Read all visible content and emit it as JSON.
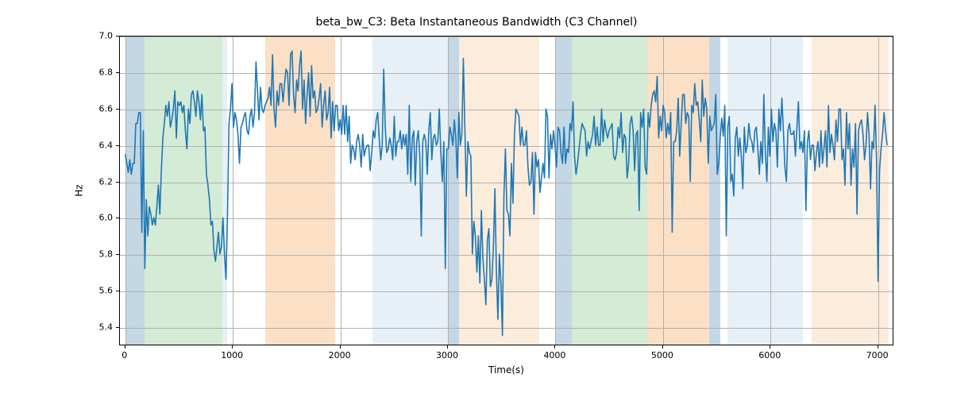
{
  "chart_data": {
    "type": "line",
    "title": "beta_bw_C3: Beta Instantaneous Bandwidth (C3 Channel)",
    "xlabel": "Time(s)",
    "ylabel": "Hz",
    "xlim": [
      -50,
      7150
    ],
    "ylim": [
      5.3,
      7.0
    ],
    "xticks": [
      0,
      1000,
      2000,
      3000,
      4000,
      5000,
      6000,
      7000
    ],
    "yticks": [
      5.4,
      5.6,
      5.8,
      6.0,
      6.2,
      6.4,
      6.6,
      6.8,
      7.0
    ],
    "bands": [
      {
        "start": 0,
        "end": 180,
        "color": "#b9d0df"
      },
      {
        "start": 180,
        "end": 900,
        "color": "#cde7ce"
      },
      {
        "start": 900,
        "end": 950,
        "color": "#e3edf4"
      },
      {
        "start": 1300,
        "end": 1950,
        "color": "#fbdabb"
      },
      {
        "start": 2300,
        "end": 3000,
        "color": "#e3edf4"
      },
      {
        "start": 3000,
        "end": 3100,
        "color": "#b9d0df"
      },
      {
        "start": 3100,
        "end": 3850,
        "color": "#fbe9d6"
      },
      {
        "start": 4000,
        "end": 4150,
        "color": "#b9d0df"
      },
      {
        "start": 4150,
        "end": 4850,
        "color": "#cde7ce"
      },
      {
        "start": 4850,
        "end": 5430,
        "color": "#fbdabb"
      },
      {
        "start": 5430,
        "end": 5530,
        "color": "#b9d0df"
      },
      {
        "start": 5600,
        "end": 6300,
        "color": "#e3edf4"
      },
      {
        "start": 6380,
        "end": 7100,
        "color": "#fbe9d6"
      }
    ],
    "x": [
      0,
      14,
      28,
      42,
      56,
      70,
      84,
      98,
      112,
      126,
      140,
      154,
      168,
      182,
      196,
      210,
      224,
      238,
      252,
      266,
      280,
      294,
      308,
      322,
      336,
      350,
      364,
      378,
      392,
      406,
      420,
      434,
      448,
      462,
      476,
      490,
      504,
      518,
      532,
      546,
      560,
      574,
      588,
      602,
      616,
      630,
      644,
      658,
      672,
      686,
      700,
      714,
      728,
      742,
      756,
      770,
      784,
      798,
      812,
      826,
      840,
      854,
      868,
      882,
      896,
      910,
      924,
      938,
      952,
      966,
      980,
      994,
      1008,
      1022,
      1036,
      1050,
      1064,
      1078,
      1092,
      1106,
      1120,
      1134,
      1148,
      1162,
      1176,
      1190,
      1204,
      1218,
      1232,
      1246,
      1260,
      1274,
      1288,
      1302,
      1316,
      1330,
      1344,
      1358,
      1372,
      1386,
      1400,
      1414,
      1428,
      1442,
      1456,
      1470,
      1484,
      1498,
      1512,
      1526,
      1540,
      1554,
      1568,
      1582,
      1596,
      1610,
      1624,
      1638,
      1652,
      1666,
      1680,
      1694,
      1708,
      1722,
      1736,
      1750,
      1764,
      1778,
      1792,
      1806,
      1820,
      1834,
      1848,
      1862,
      1876,
      1890,
      1904,
      1918,
      1932,
      1946,
      1960,
      1974,
      1988,
      2002,
      2016,
      2030,
      2044,
      2058,
      2072,
      2086,
      2100,
      2114,
      2128,
      2142,
      2156,
      2170,
      2184,
      2198,
      2212,
      2226,
      2240,
      2254,
      2268,
      2282,
      2296,
      2310,
      2324,
      2338,
      2352,
      2366,
      2380,
      2394,
      2408,
      2422,
      2436,
      2450,
      2464,
      2478,
      2492,
      2506,
      2520,
      2534,
      2548,
      2562,
      2576,
      2590,
      2604,
      2618,
      2632,
      2646,
      2660,
      2674,
      2688,
      2702,
      2716,
      2730,
      2744,
      2758,
      2772,
      2786,
      2800,
      2814,
      2828,
      2842,
      2856,
      2870,
      2884,
      2898,
      2912,
      2926,
      2940,
      2954,
      2968,
      2982,
      2996,
      3010,
      3024,
      3038,
      3052,
      3066,
      3080,
      3094,
      3108,
      3122,
      3136,
      3150,
      3164,
      3178,
      3192,
      3206,
      3220,
      3234,
      3248,
      3262,
      3276,
      3290,
      3304,
      3318,
      3332,
      3346,
      3360,
      3374,
      3388,
      3402,
      3416,
      3430,
      3444,
      3458,
      3472,
      3486,
      3500,
      3514,
      3528,
      3542,
      3556,
      3570,
      3584,
      3598,
      3612,
      3626,
      3640,
      3654,
      3668,
      3682,
      3696,
      3710,
      3724,
      3738,
      3752,
      3766,
      3780,
      3794,
      3808,
      3822,
      3836,
      3850,
      3864,
      3878,
      3892,
      3906,
      3920,
      3934,
      3948,
      3962,
      3976,
      3990,
      4004,
      4018,
      4032,
      4046,
      4060,
      4074,
      4088,
      4102,
      4116,
      4130,
      4144,
      4158,
      4172,
      4186,
      4200,
      4214,
      4228,
      4242,
      4256,
      4270,
      4284,
      4298,
      4312,
      4326,
      4340,
      4354,
      4368,
      4382,
      4396,
      4410,
      4424,
      4438,
      4452,
      4466,
      4480,
      4494,
      4508,
      4522,
      4536,
      4550,
      4564,
      4578,
      4592,
      4606,
      4620,
      4634,
      4648,
      4662,
      4676,
      4690,
      4704,
      4718,
      4732,
      4746,
      4760,
      4774,
      4788,
      4802,
      4816,
      4830,
      4844,
      4858,
      4872,
      4886,
      4900,
      4914,
      4928,
      4942,
      4956,
      4970,
      4984,
      4998,
      5012,
      5026,
      5040,
      5054,
      5068,
      5082,
      5096,
      5110,
      5124,
      5138,
      5152,
      5166,
      5180,
      5194,
      5208,
      5222,
      5236,
      5250,
      5264,
      5278,
      5292,
      5306,
      5320,
      5334,
      5348,
      5362,
      5376,
      5390,
      5404,
      5418,
      5432,
      5446,
      5460,
      5474,
      5488,
      5502,
      5516,
      5530,
      5544,
      5558,
      5572,
      5586,
      5600,
      5614,
      5628,
      5642,
      5656,
      5670,
      5684,
      5698,
      5712,
      5726,
      5740,
      5754,
      5768,
      5782,
      5796,
      5810,
      5824,
      5838,
      5852,
      5866,
      5880,
      5894,
      5908,
      5922,
      5936,
      5950,
      5964,
      5978,
      5992,
      6006,
      6020,
      6034,
      6048,
      6062,
      6076,
      6090,
      6104,
      6118,
      6132,
      6146,
      6160,
      6174,
      6188,
      6202,
      6216,
      6230,
      6244,
      6258,
      6272,
      6286,
      6300,
      6314,
      6328,
      6342,
      6356,
      6370,
      6384,
      6398,
      6412,
      6426,
      6440,
      6454,
      6468,
      6482,
      6496,
      6510,
      6524,
      6538,
      6552,
      6566,
      6580,
      6594,
      6608,
      6622,
      6636,
      6650,
      6664,
      6678,
      6692,
      6706,
      6720,
      6734,
      6748,
      6762,
      6776,
      6790,
      6804,
      6818,
      6832,
      6846,
      6860,
      6874,
      6888,
      6902,
      6916,
      6930,
      6944,
      6958,
      6972,
      6986,
      7000,
      7014,
      7028,
      7042,
      7056,
      7070,
      7084,
      7098
    ],
    "values": [
      6.35,
      6.3,
      6.25,
      6.32,
      6.24,
      6.3,
      6.3,
      6.52,
      6.52,
      6.58,
      6.58,
      5.92,
      6.48,
      5.72,
      6.1,
      5.9,
      6.06,
      6.02,
      5.96,
      6.0,
      5.96,
      6.06,
      6.18,
      6.02,
      6.26,
      6.44,
      6.52,
      6.62,
      6.56,
      6.64,
      6.5,
      6.54,
      6.6,
      6.7,
      6.44,
      6.64,
      6.62,
      6.64,
      6.58,
      6.62,
      6.48,
      6.38,
      6.6,
      6.52,
      6.68,
      6.7,
      6.64,
      6.56,
      6.7,
      6.64,
      6.54,
      6.68,
      6.48,
      6.5,
      6.24,
      6.18,
      6.1,
      5.96,
      5.98,
      5.82,
      5.76,
      5.84,
      5.92,
      5.8,
      5.84,
      6.0,
      5.8,
      5.66,
      6.0,
      6.52,
      6.6,
      6.74,
      6.5,
      6.58,
      6.54,
      6.46,
      6.3,
      6.5,
      6.52,
      6.56,
      6.58,
      6.48,
      6.46,
      6.56,
      6.6,
      6.5,
      6.58,
      6.86,
      6.7,
      6.54,
      6.72,
      6.6,
      6.58,
      6.62,
      6.64,
      6.66,
      6.72,
      6.62,
      6.9,
      6.6,
      6.5,
      6.7,
      6.62,
      6.74,
      6.74,
      6.64,
      6.74,
      6.82,
      6.8,
      6.62,
      6.9,
      6.92,
      6.68,
      6.58,
      6.76,
      6.7,
      6.84,
      6.92,
      6.6,
      6.76,
      6.52,
      6.68,
      6.8,
      6.56,
      6.84,
      6.66,
      6.7,
      6.58,
      6.6,
      6.66,
      6.74,
      6.5,
      6.62,
      6.7,
      6.54,
      6.58,
      6.72,
      6.44,
      6.64,
      6.48,
      6.62,
      6.62,
      6.48,
      6.54,
      6.46,
      6.62,
      6.46,
      6.62,
      6.42,
      6.56,
      6.3,
      6.4,
      6.38,
      6.32,
      6.42,
      6.46,
      6.4,
      6.28,
      6.46,
      6.34,
      6.38,
      6.4,
      6.4,
      6.26,
      6.36,
      6.48,
      6.44,
      6.54,
      6.58,
      6.44,
      6.32,
      6.4,
      6.82,
      6.5,
      6.36,
      6.38,
      6.44,
      6.4,
      6.32,
      6.56,
      6.34,
      6.42,
      6.42,
      6.48,
      6.38,
      6.46,
      6.4,
      6.46,
      6.24,
      6.62,
      6.2,
      6.44,
      6.48,
      6.18,
      6.42,
      6.48,
      6.34,
      5.9,
      6.42,
      6.46,
      6.42,
      6.24,
      6.48,
      6.58,
      6.32,
      6.44,
      6.46,
      6.4,
      6.42,
      6.6,
      6.36,
      6.2,
      6.42,
      5.72,
      6.38,
      6.38,
      6.5,
      6.46,
      6.4,
      6.54,
      6.44,
      6.22,
      6.58,
      6.4,
      6.46,
      6.88,
      6.5,
      6.12,
      6.42,
      6.36,
      6.34,
      5.8,
      5.98,
      5.9,
      5.7,
      5.9,
      5.64,
      6.04,
      5.78,
      5.66,
      5.52,
      5.88,
      5.94,
      5.62,
      5.66,
      5.84,
      6.16,
      5.7,
      5.44,
      5.8,
      5.64,
      5.35,
      6.12,
      6.38,
      6.04,
      6.02,
      5.9,
      6.3,
      6.08,
      6.46,
      6.6,
      6.58,
      6.56,
      6.4,
      6.5,
      6.4,
      6.4,
      6.48,
      6.28,
      6.18,
      6.2,
      6.36,
      6.02,
      6.36,
      6.28,
      6.32,
      6.14,
      6.22,
      6.3,
      6.22,
      6.6,
      6.56,
      6.22,
      6.46,
      6.38,
      6.48,
      6.4,
      6.28,
      6.5,
      6.48,
      6.36,
      6.3,
      6.5,
      6.3,
      6.38,
      6.36,
      6.52,
      6.48,
      6.64,
      6.34,
      6.24,
      6.3,
      6.38,
      6.46,
      6.52,
      6.5,
      6.48,
      6.34,
      6.42,
      6.38,
      6.42,
      6.46,
      6.56,
      6.4,
      6.5,
      6.4,
      6.4,
      6.6,
      6.42,
      6.54,
      6.48,
      6.44,
      6.48,
      6.5,
      6.52,
      6.34,
      6.32,
      6.36,
      6.5,
      6.44,
      6.58,
      6.36,
      6.46,
      6.44,
      6.22,
      6.3,
      6.52,
      6.56,
      6.48,
      6.26,
      6.46,
      6.48,
      6.04,
      6.58,
      6.5,
      6.6,
      6.28,
      6.24,
      6.58,
      6.5,
      6.62,
      6.68,
      6.7,
      6.64,
      6.78,
      6.44,
      6.56,
      6.48,
      6.62,
      6.58,
      6.44,
      6.52,
      6.46,
      6.58,
      5.92,
      6.42,
      6.42,
      6.48,
      6.66,
      6.34,
      6.52,
      6.68,
      6.68,
      6.52,
      6.58,
      6.56,
      6.2,
      6.62,
      6.58,
      6.74,
      6.62,
      6.64,
      6.54,
      6.42,
      6.76,
      6.56,
      6.66,
      6.6,
      6.3,
      6.56,
      6.48,
      6.5,
      6.52,
      6.68,
      6.24,
      6.3,
      6.45,
      6.55,
      6.45,
      6.62,
      5.9,
      6.5,
      6.56,
      6.2,
      6.24,
      6.12,
      6.44,
      6.5,
      6.34,
      6.44,
      6.34,
      6.16,
      6.5,
      6.36,
      6.4,
      6.52,
      6.44,
      6.42,
      6.36,
      6.48,
      6.5,
      6.38,
      6.24,
      6.42,
      6.3,
      6.68,
      6.36,
      6.2,
      6.5,
      6.34,
      6.6,
      6.42,
      6.52,
      6.48,
      6.28,
      6.6,
      6.48,
      6.66,
      6.48,
      6.28,
      6.2,
      6.48,
      6.52,
      6.46,
      6.46,
      6.48,
      6.34,
      6.5,
      6.64,
      6.38,
      6.42,
      6.36,
      6.48,
      6.04,
      6.42,
      6.48,
      6.32,
      6.4,
      6.4,
      6.26,
      6.36,
      6.42,
      6.28,
      6.48,
      6.3,
      6.38,
      6.48,
      6.28,
      6.62,
      6.36,
      6.46,
      6.4,
      6.32,
      6.54,
      6.42,
      6.6,
      6.6,
      6.32,
      6.38,
      6.18,
      6.58,
      6.38,
      6.52,
      6.18,
      6.38,
      6.28,
      6.52,
      6.02,
      6.48,
      6.52,
      6.54,
      6.46,
      6.32,
      6.4,
      6.58,
      6.46,
      6.16,
      6.42,
      6.38,
      6.62,
      6.32,
      5.65,
      6.26,
      6.38,
      6.46,
      6.58,
      6.48,
      6.4,
      6.58,
      6.42
    ]
  }
}
